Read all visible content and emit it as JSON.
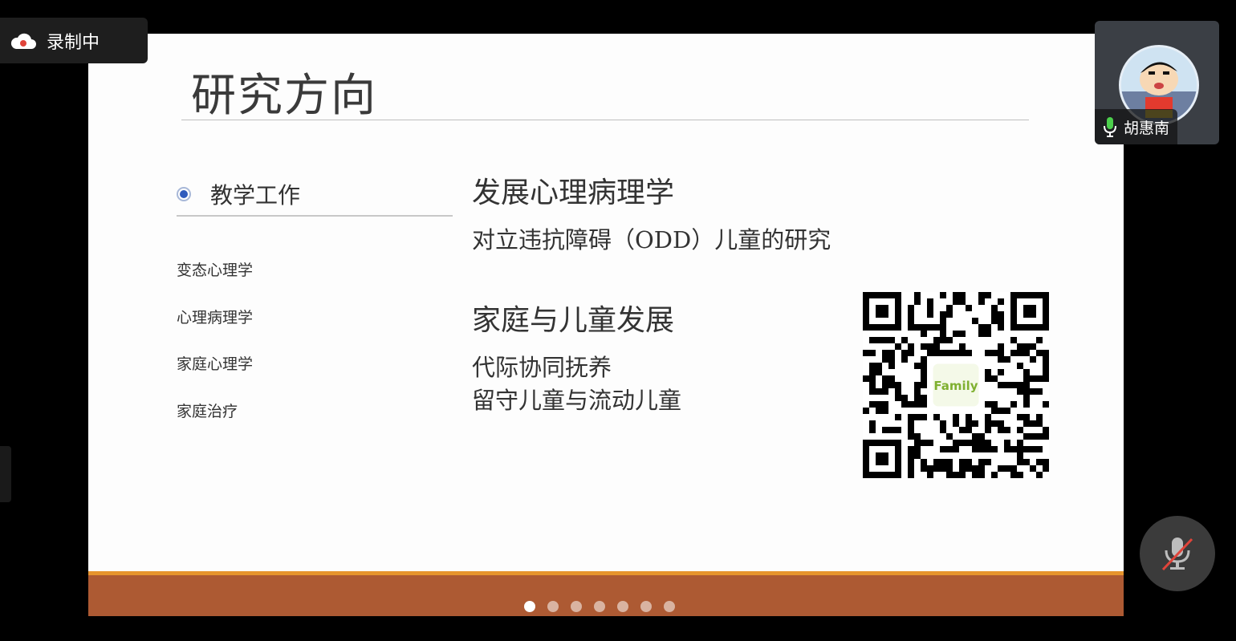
{
  "recording": {
    "label": "录制中",
    "icon": "cloud-icon"
  },
  "slide": {
    "title": "研究方向",
    "tab_label": "教学工作",
    "courses": [
      "变态心理学",
      "心理病理学",
      "家庭心理学",
      "家庭治疗"
    ],
    "sections": [
      {
        "heading": "发展心理病理学",
        "items": [
          "对立违抗障碍（ODD）儿童的研究"
        ]
      },
      {
        "heading": "家庭与儿童发展",
        "items": [
          "代际协同抚养",
          "留守儿童与流动儿童"
        ]
      }
    ],
    "qr_center_text": "Family",
    "pagination": {
      "total": 7,
      "current": 1
    }
  },
  "participant": {
    "name": "胡惠南",
    "mic_icon": "mic-on-icon"
  },
  "controls": {
    "mute_icon": "mic-muted-icon"
  },
  "colors": {
    "footer": "#ad5a33",
    "footer_stripe": "#e7952d",
    "accent": "#2f5bbd"
  }
}
